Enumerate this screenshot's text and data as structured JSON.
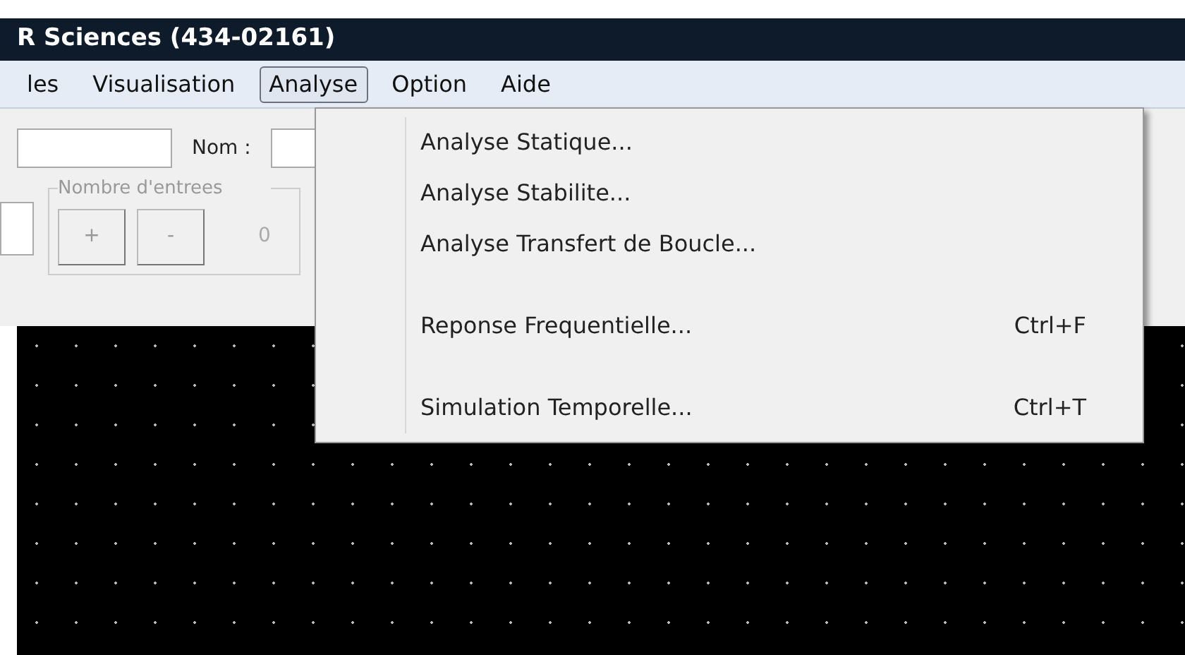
{
  "window": {
    "title": "R Sciences (434-02161)"
  },
  "menu_bar": [
    {
      "label": "les",
      "selected": false
    },
    {
      "label": "Visualisation",
      "selected": false
    },
    {
      "label": "Analyse",
      "selected": true
    },
    {
      "label": "Option",
      "selected": false
    },
    {
      "label": "Aide",
      "selected": false
    }
  ],
  "toolbar": {
    "nom_label": "Nom :",
    "inputs_label": "Nombre d'entrees",
    "plus_button": "+",
    "minus_button": "-",
    "count": "0"
  },
  "dropdown": {
    "groups": [
      {
        "items": [
          {
            "label": "Analyse Statique..."
          },
          {
            "label": "Analyse Stabilite..."
          },
          {
            "label": "Analyse Transfert de Boucle..."
          }
        ]
      },
      {
        "items": [
          {
            "label": "Reponse Frequentielle...",
            "shortcut": "Ctrl+F"
          }
        ]
      },
      {
        "items": [
          {
            "label": "Simulation Temporelle...",
            "shortcut": "Ctrl+T"
          }
        ]
      }
    ]
  }
}
